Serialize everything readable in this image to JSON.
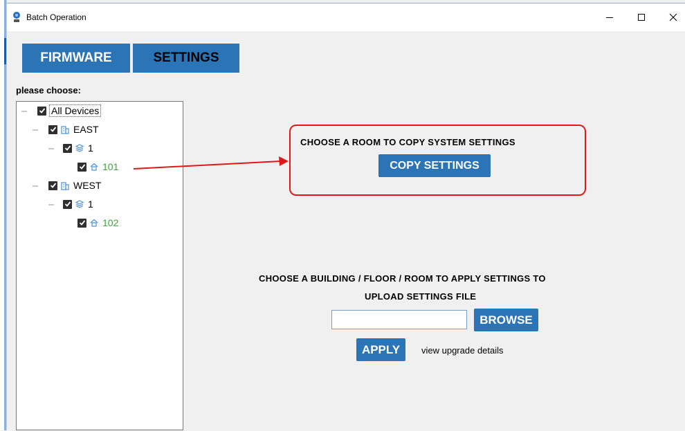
{
  "window": {
    "title": "Batch Operation",
    "controls": [
      "minimize",
      "maximize",
      "close"
    ]
  },
  "tabs": [
    {
      "label": "FIRMWARE",
      "active": false
    },
    {
      "label": "SETTINGS",
      "active": true
    }
  ],
  "tree": {
    "label": "please choose:",
    "root": {
      "label": "All Devices",
      "checked": true
    },
    "buildings": [
      {
        "label": "EAST",
        "checked": true,
        "floor": {
          "label": "1",
          "checked": true
        },
        "room": {
          "label": "101",
          "checked": true
        }
      },
      {
        "label": "WEST",
        "checked": true,
        "floor": {
          "label": "1",
          "checked": true
        },
        "room": {
          "label": "102",
          "checked": true
        }
      }
    ]
  },
  "copy_section": {
    "heading": "CHOOSE A ROOM TO COPY SYSTEM SETTINGS",
    "button": "COPY SETTINGS"
  },
  "apply_section": {
    "heading1": "CHOOSE A BUILDING / FLOOR / ROOM TO APPLY SETTINGS TO",
    "heading2": "UPLOAD SETTINGS FILE",
    "file_value": "",
    "browse": "BROWSE",
    "apply": "APPLY",
    "details_link": "view upgrade details"
  },
  "colors": {
    "accent": "#2b74b6",
    "callout": "#e01818",
    "room_text": "#3aa63a",
    "tree_icon": "#4a90d9"
  },
  "icons": [
    "app-icon",
    "checkbox-checked-icon",
    "building-icon",
    "floor-layers-icon",
    "room-home-icon",
    "minimize-icon",
    "maximize-icon",
    "close-icon"
  ]
}
